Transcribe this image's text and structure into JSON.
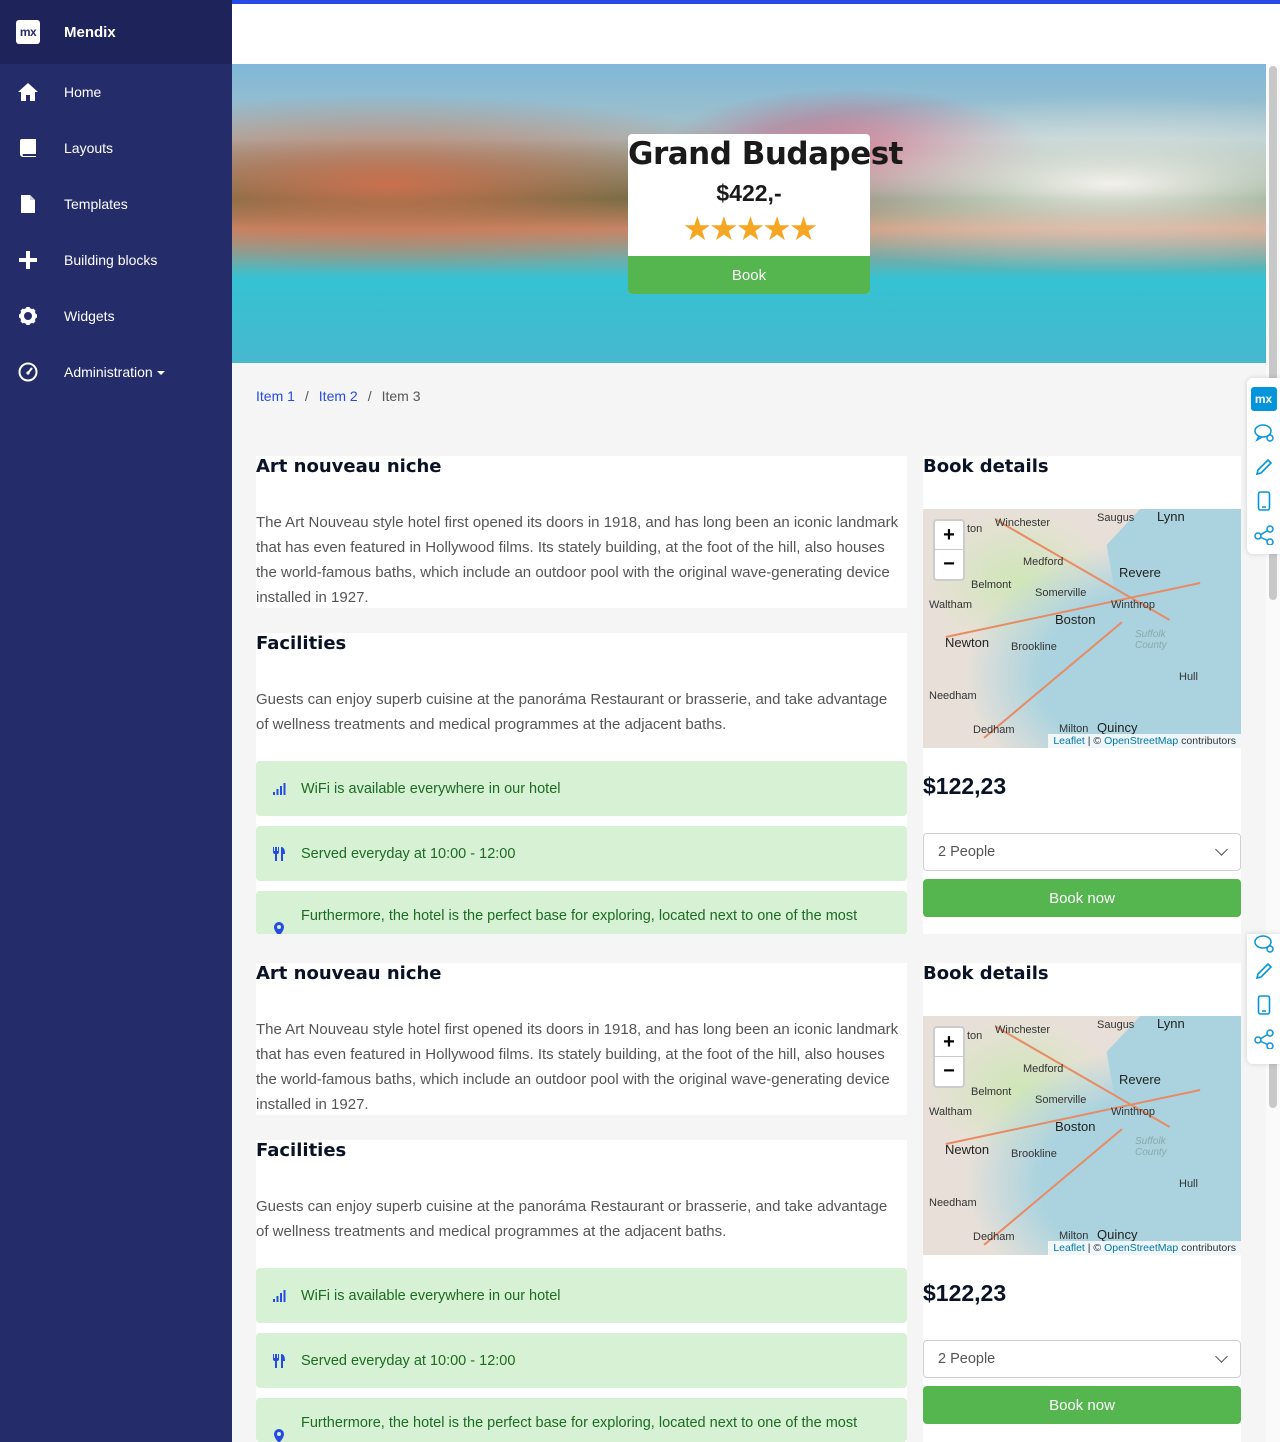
{
  "brand": {
    "logo": "mx",
    "name": "Mendix"
  },
  "sidebar": {
    "items": [
      {
        "label": "Home",
        "icon": "home-icon"
      },
      {
        "label": "Layouts",
        "icon": "book-icon"
      },
      {
        "label": "Templates",
        "icon": "file-icon"
      },
      {
        "label": "Building blocks",
        "icon": "plus-icon"
      },
      {
        "label": "Widgets",
        "icon": "gear-icon"
      },
      {
        "label": "Administration",
        "icon": "dashboard-icon"
      }
    ]
  },
  "hero": {
    "title": "Grand Budapest",
    "price": "$422,-",
    "rating": 5,
    "stars": "★★★★★",
    "button": "Book"
  },
  "breadcrumb": {
    "items": [
      "Item 1",
      "Item 2",
      "Item 3"
    ],
    "separator": "/"
  },
  "floatbar": {
    "logo": "mx"
  },
  "sections": [
    {
      "about": {
        "title": "Art nouveau niche",
        "text": "The Art Nouveau style hotel first opened its doors in 1918, and has long been an iconic landmark that has even featured in Hollywood films. Its stately building, at the foot of the hill, also houses the world-famous baths, which include an outdoor pool with the original wave-generating device installed in 1927."
      },
      "facilities": {
        "title": "Facilities",
        "text": "Guests can enjoy superb cuisine at the panoráma Restaurant or brasserie, and take advantage of wellness treatments and medical programmes at the adjacent baths.",
        "alerts": [
          {
            "icon": "signal-icon",
            "text": "WiFi is available everywhere in our hotel"
          },
          {
            "icon": "cutlery-icon",
            "text": "Served everyday at 10:00 - 12:00"
          },
          {
            "icon": "map-marker-icon",
            "text": "Furthermore, the hotel is the perfect base for exploring, located next to one of the most"
          }
        ]
      },
      "book": {
        "title": "Book details",
        "map": {
          "zoom_in": "+",
          "zoom_out": "−",
          "labels": [
            "Winchester",
            "Saugus",
            "Lynn",
            "Medford",
            "Revere",
            "Belmont",
            "Somerville",
            "Winthrop",
            "Waltham",
            "Boston",
            "Newton",
            "Brookline",
            "Suffolk County",
            "Hull",
            "Needham",
            "Dedham",
            "Milton",
            "Quincy",
            "ton"
          ],
          "attribution_leaflet": "Leaflet",
          "attribution_sep": " | © ",
          "attribution_osm": "OpenStreetMap",
          "attribution_tail": " contributors"
        },
        "price": "$122,23",
        "select_value": "2 People",
        "button": "Book now"
      }
    },
    {
      "about": {
        "title": "Art nouveau niche",
        "text": "The Art Nouveau style hotel first opened its doors in 1918, and has long been an iconic landmark that has even featured in Hollywood films. Its stately building, at the foot of the hill, also houses the world-famous baths, which include an outdoor pool with the original wave-generating device installed in 1927."
      },
      "facilities": {
        "title": "Facilities",
        "text": "Guests can enjoy superb cuisine at the panoráma Restaurant or brasserie, and take advantage of wellness treatments and medical programmes at the adjacent baths.",
        "alerts": [
          {
            "icon": "signal-icon",
            "text": "WiFi is available everywhere in our hotel"
          },
          {
            "icon": "cutlery-icon",
            "text": "Served everyday at 10:00 - 12:00"
          },
          {
            "icon": "map-marker-icon",
            "text": "Furthermore, the hotel is the perfect base for exploring, located next to one of the most"
          }
        ]
      },
      "book": {
        "title": "Book details",
        "map": {
          "zoom_in": "+",
          "zoom_out": "−",
          "labels": [
            "Winchester",
            "Saugus",
            "Lynn",
            "Medford",
            "Revere",
            "Belmont",
            "Somerville",
            "Winthrop",
            "Waltham",
            "Boston",
            "Newton",
            "Brookline",
            "Suffolk County",
            "Hull",
            "Needham",
            "Dedham",
            "Milton",
            "Quincy",
            "ton"
          ],
          "attribution_leaflet": "Leaflet",
          "attribution_sep": " | © ",
          "attribution_osm": "OpenStreetMap",
          "attribution_tail": " contributors"
        },
        "price": "$122,23",
        "select_value": "2 People",
        "button": "Book now"
      }
    }
  ],
  "colors": {
    "sidebar": "#252c6a",
    "brand_bar": "#1e2459",
    "accent": "#264ae5",
    "success": "#55b54f",
    "alert_bg": "#d7f1d4",
    "alert_text": "#1c6b24",
    "stars": "#f5a623"
  }
}
